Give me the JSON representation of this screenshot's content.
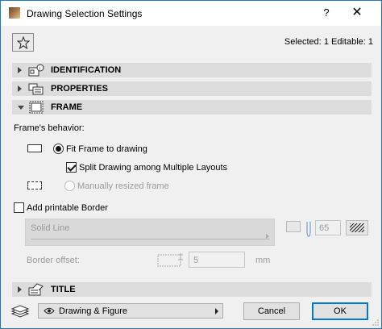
{
  "window": {
    "title": "Drawing Selection Settings",
    "help_label": "?",
    "close_label": "✕"
  },
  "header": {
    "selected_info": "Selected: 1 Editable: 1"
  },
  "panels": {
    "identification": "IDENTIFICATION",
    "properties": "PROPERTIES",
    "frame": "FRAME",
    "title": "TITLE"
  },
  "frame": {
    "behavior_label": "Frame's behavior:",
    "fit_frame_label": "Fit Frame to drawing",
    "fit_frame_checked": true,
    "split_drawing_label": "Split Drawing among Multiple Layouts",
    "split_drawing_checked": true,
    "manual_resize_label": "Manually resized frame",
    "manual_resize_checked": false,
    "printable_border_label": "Add printable Border",
    "printable_border_checked": false,
    "line_type_value": "Solid Line",
    "pen_value": "65",
    "border_offset_label": "Border offset:",
    "border_offset_value": "5",
    "border_offset_unit": "mm"
  },
  "footer": {
    "view_select_value": "Drawing & Figure",
    "cancel_label": "Cancel",
    "ok_label": "OK"
  },
  "colors": {
    "accent": "#0078d7",
    "panel_header_bg": "#dcdcdc",
    "disabled_text": "#9a9a9a"
  }
}
